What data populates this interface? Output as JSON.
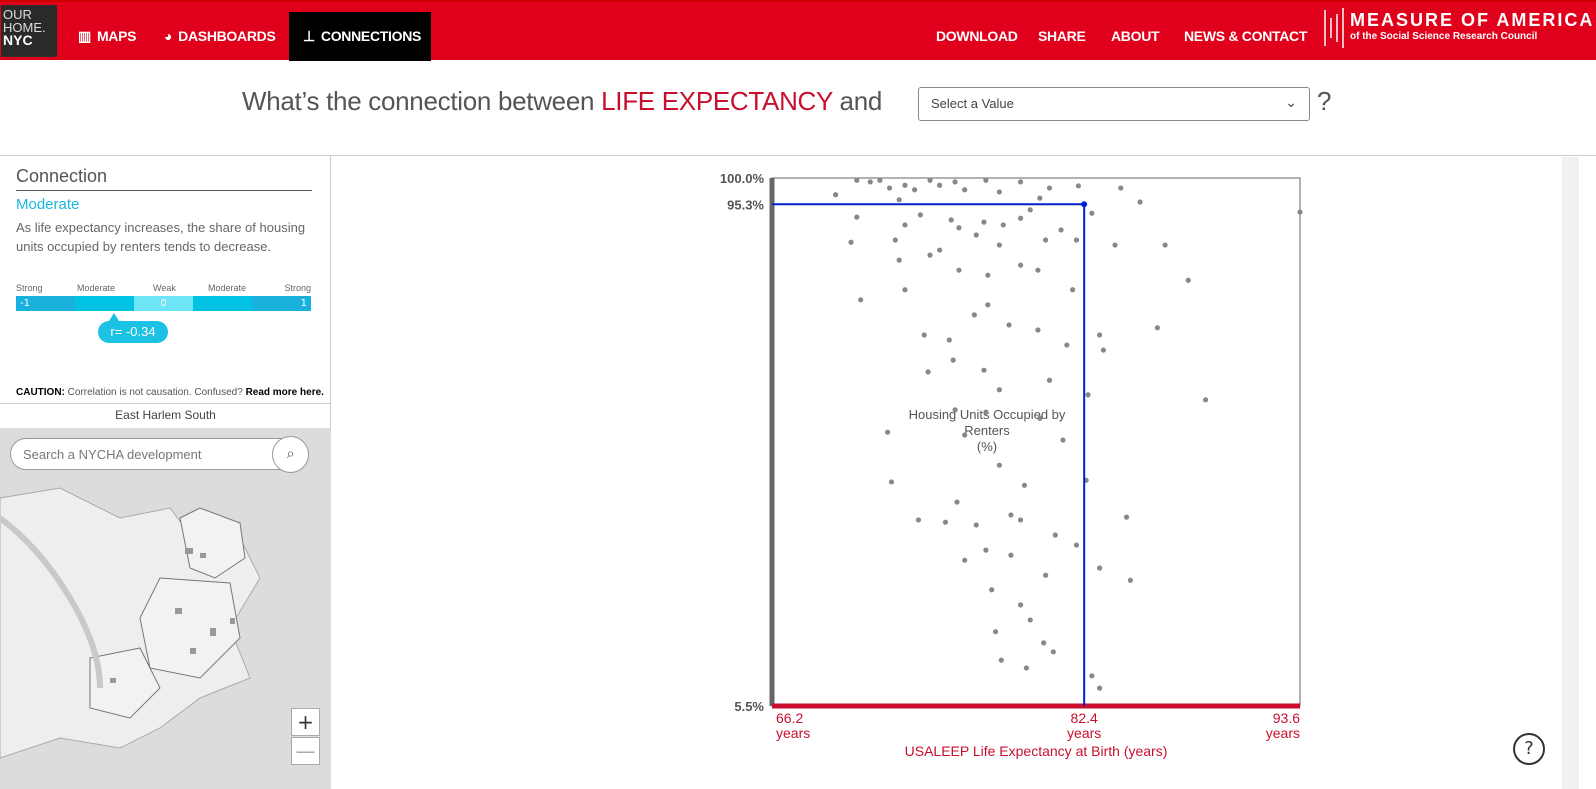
{
  "nav": {
    "logo": {
      "l1": "OUR",
      "l2": "HOME.",
      "l3": "NYC"
    },
    "items": [
      {
        "label": "MAPS",
        "icon": "map-icon"
      },
      {
        "label": "DASHBOARDS",
        "icon": "pie-chart-icon"
      },
      {
        "label": "CONNECTIONS",
        "icon": "sitemap-icon",
        "active": true
      }
    ],
    "right": [
      "DOWNLOAD",
      "SHARE",
      "ABOUT",
      "NEWS & CONTACT"
    ],
    "brand": {
      "title": "MEASURE OF AMERICA",
      "subtitle": "of the Social Science Research Council"
    }
  },
  "question": {
    "prefix": "What’s the connection between",
    "variable": "LIFE EXPECTANCY",
    "and": "and",
    "select_value": "Select a Value",
    "suffix": "?"
  },
  "sidebar": {
    "heading": "Connection",
    "strength": "Moderate",
    "description": "As life expectancy increases, the share of housing units occupied by renters tends to decrease.",
    "scale_labels": [
      "Strong",
      "Moderate",
      "Weak",
      "Moderate",
      "Strong"
    ],
    "scale_values": {
      "min": "-1",
      "mid": "0",
      "max": "1"
    },
    "r_label": "r= -0.34",
    "r": -0.34,
    "caution_label": "CAUTION:",
    "caution_text": " Correlation is not causation. Confused? ",
    "caution_link": "Read more here.",
    "map_title": "East Harlem South",
    "search_placeholder": "Search a NYCHA development",
    "zoom_in": "+",
    "zoom_out": "—"
  },
  "colors": {
    "nav": "#e0001b",
    "accent": "#c8102e",
    "correlation": "#1cc2e3",
    "selection": "#0022cc"
  },
  "chart_data": {
    "type": "scatter",
    "xlabel": "USALEEP Life Expectancy at Birth (years)",
    "ylabel": "Housing Units Occupied by Renters",
    "ylabel_unit": "(%)",
    "xlim": [
      66.2,
      93.6
    ],
    "ylim": [
      5.5,
      100.0
    ],
    "x_ticks": [
      {
        "value": 66.2,
        "label": "66.2",
        "unit": "years"
      },
      {
        "value": 82.4,
        "label": "82.4",
        "unit": "years"
      },
      {
        "value": 93.6,
        "label": "93.6",
        "unit": "years"
      }
    ],
    "y_ticks": [
      {
        "value": 100.0,
        "label": "100.0%"
      },
      {
        "value": 95.3,
        "label": "95.3%"
      },
      {
        "value": 5.5,
        "label": "5.5%"
      }
    ],
    "selected": {
      "name": "East Harlem South",
      "x": 82.4,
      "y": 95.3
    },
    "points": [
      [
        69.5,
        97.0
      ],
      [
        70.6,
        99.6
      ],
      [
        71.8,
        99.6
      ],
      [
        73.1,
        98.7
      ],
      [
        74.4,
        99.6
      ],
      [
        75.7,
        99.3
      ],
      [
        77.3,
        99.6
      ],
      [
        79.1,
        99.3
      ],
      [
        80.6,
        98.2
      ],
      [
        82.1,
        98.6
      ],
      [
        84.3,
        98.2
      ],
      [
        85.3,
        95.7
      ],
      [
        93.6,
        93.9
      ],
      [
        70.6,
        93.0
      ],
      [
        72.8,
        96.1
      ],
      [
        73.9,
        93.4
      ],
      [
        75.5,
        92.5
      ],
      [
        76.8,
        89.8
      ],
      [
        78.0,
        88.0
      ],
      [
        79.6,
        94.3
      ],
      [
        81.2,
        90.7
      ],
      [
        82.8,
        93.7
      ],
      [
        84.0,
        88.0
      ],
      [
        86.6,
        88.0
      ],
      [
        87.8,
        81.7
      ],
      [
        70.3,
        88.5
      ],
      [
        72.6,
        88.9
      ],
      [
        74.9,
        87.1
      ],
      [
        75.9,
        83.5
      ],
      [
        77.4,
        82.6
      ],
      [
        79.1,
        84.4
      ],
      [
        70.8,
        78.2
      ],
      [
        73.1,
        80.0
      ],
      [
        74.1,
        71.9
      ],
      [
        75.4,
        71.0
      ],
      [
        76.7,
        75.5
      ],
      [
        77.4,
        77.3
      ],
      [
        78.5,
        73.7
      ],
      [
        80.0,
        72.8
      ],
      [
        81.5,
        70.1
      ],
      [
        83.2,
        71.9
      ],
      [
        83.4,
        69.2
      ],
      [
        86.2,
        73.2
      ],
      [
        74.3,
        65.3
      ],
      [
        75.6,
        67.4
      ],
      [
        77.2,
        65.6
      ],
      [
        78.0,
        62.1
      ],
      [
        80.6,
        63.8
      ],
      [
        82.6,
        61.2
      ],
      [
        88.7,
        60.3
      ],
      [
        75.7,
        58.5
      ],
      [
        77.3,
        58.1
      ],
      [
        80.1,
        57.0
      ],
      [
        72.2,
        54.5
      ],
      [
        76.2,
        54.0
      ],
      [
        81.3,
        53.1
      ],
      [
        78.0,
        48.6
      ],
      [
        72.4,
        45.6
      ],
      [
        75.8,
        42.0
      ],
      [
        79.3,
        45.0
      ],
      [
        82.5,
        45.9
      ],
      [
        73.8,
        38.8
      ],
      [
        75.2,
        38.4
      ],
      [
        76.8,
        37.9
      ],
      [
        78.6,
        39.7
      ],
      [
        79.1,
        38.8
      ],
      [
        80.9,
        36.1
      ],
      [
        84.6,
        39.3
      ],
      [
        77.3,
        33.4
      ],
      [
        78.6,
        32.5
      ],
      [
        80.4,
        28.9
      ],
      [
        83.2,
        30.2
      ],
      [
        84.8,
        28.0
      ],
      [
        77.6,
        26.3
      ],
      [
        79.1,
        23.6
      ],
      [
        79.6,
        20.9
      ],
      [
        77.8,
        18.8
      ],
      [
        80.3,
        16.8
      ],
      [
        78.1,
        13.7
      ],
      [
        79.4,
        12.3
      ],
      [
        80.8,
        15.2
      ],
      [
        82.8,
        10.9
      ],
      [
        83.2,
        8.7
      ],
      [
        76.2,
        31.6
      ],
      [
        82.0,
        34.3
      ],
      [
        71.3,
        99.3
      ],
      [
        72.3,
        98.2
      ],
      [
        73.6,
        97.9
      ],
      [
        74.9,
        98.7
      ],
      [
        76.2,
        97.9
      ],
      [
        78.0,
        97.5
      ],
      [
        80.1,
        96.4
      ],
      [
        73.1,
        91.6
      ],
      [
        75.9,
        91.1
      ],
      [
        77.2,
        92.1
      ],
      [
        78.2,
        91.6
      ],
      [
        79.1,
        92.8
      ],
      [
        80.4,
        88.9
      ],
      [
        82.0,
        88.9
      ],
      [
        72.8,
        85.3
      ],
      [
        74.4,
        86.2
      ],
      [
        81.8,
        80.0
      ],
      [
        80.0,
        83.5
      ]
    ]
  },
  "help": "?"
}
